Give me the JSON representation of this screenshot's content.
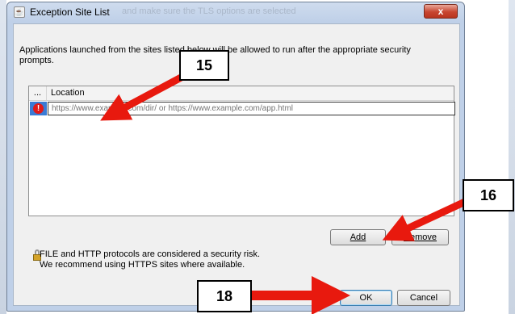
{
  "background": {
    "title_fragment": "and make sure the TLS options are selected"
  },
  "dialog": {
    "title": "Exception Site List",
    "close_label": "x",
    "description": "Applications launched from the sites listed below will be allowed to run after the appropriate security prompts.",
    "table": {
      "col_status": "...",
      "col_location": "Location",
      "rows": [
        {
          "status_icon": "error-icon",
          "placeholder": "https://www.example.com/dir/ or https://www.example.com/app.html"
        }
      ]
    },
    "add_label": "Add",
    "remove_label": "Remove",
    "security_line1": "FILE and HTTP protocols are considered a security risk.",
    "security_line2": "We recommend using HTTPS sites where available.",
    "ok_label": "OK",
    "cancel_label": "Cancel"
  },
  "annotations": {
    "step_15": "15",
    "step_16": "16",
    "step_18": "18"
  },
  "colors": {
    "arrow": "#e8190e",
    "dialog_frame": "#bfd0e8",
    "close_button": "#c8452f"
  }
}
